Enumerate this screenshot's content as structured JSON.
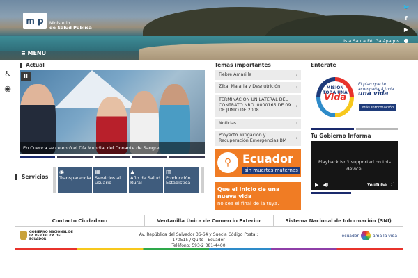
{
  "header": {
    "logo_letters": "m p",
    "logo_line1": "Ministerio",
    "logo_line2": "de Salud Pública",
    "place": "Isla Santa Fé, Galápagos",
    "menu_label": "≡ MENU",
    "social_icons": [
      "twitter-icon",
      "facebook-icon",
      "youtube-icon",
      "flickr-icon"
    ]
  },
  "left_tools": [
    "accessibility-icon",
    "eye-icon"
  ],
  "actual": {
    "title": "Actual",
    "caption": "En Cuenca se celebró el Día Mundial del Donante de Sangre",
    "slides": 5
  },
  "servicios": {
    "title": "Servicios",
    "items": [
      {
        "label": "Transparencia",
        "icon": "eye-icon"
      },
      {
        "label": "Servicios al usuario",
        "icon": "grid-icon"
      },
      {
        "label": "Año de Salud Rural",
        "icon": "graduation-cap-icon"
      },
      {
        "label": "Producción Estadística",
        "icon": "chart-icon"
      }
    ]
  },
  "temas": {
    "title": "Temas importantes",
    "items": [
      {
        "label": "Fiebre Amarilla"
      },
      {
        "label": "Zika, Malaria y Desnutrición"
      },
      {
        "label": "TERMINACIÓN UNILATERAL DEL CONTRATO NRO. 0000165 DE 09 DE JUNIO DE 2008"
      },
      {
        "label": "Noticias"
      },
      {
        "label": "Proyecto Mitigación y Recuperación Emergencias BM"
      }
    ],
    "ad1_title": "Ecuador",
    "ad1_sub": "sin muertes maternas",
    "ad2_line1": "Que el inicio de una nueva vida",
    "ad2_line2": "no sea el final de la tuya."
  },
  "enterate": {
    "title": "Entérate",
    "mision_top": "MISIÓN TODA UNA",
    "mision_word": "Vida",
    "text_line1": "El plan que te acompañará toda",
    "text_line2": "una vida",
    "button": "Más información"
  },
  "gobierno": {
    "title": "Tu Gobierno Informa",
    "video_msg": "Playback isn't supported on this device.",
    "yt_label": "YouTube"
  },
  "footer": {
    "links": [
      "Contacto Ciudadano",
      "Ventanilla Única de Comercio Exterior",
      "Sistema Nacional de Información (SNI)"
    ],
    "gob_text": "GOBIERNO NACIONAL DE LA REPÚBLICA DEL ECUADOR",
    "address1": "Av. República del Salvador 36-64 y Suecia Código Postal:",
    "address2": "170515 / Quito - Ecuador",
    "phone": "Teléfono: 593-2 381-4400",
    "brand": "ecuador",
    "brand2": "ama la vida"
  },
  "colors": {
    "accent_blue": "#1e3b7a",
    "service_blue": "#3f5c7d",
    "orange": "#f07c24"
  }
}
